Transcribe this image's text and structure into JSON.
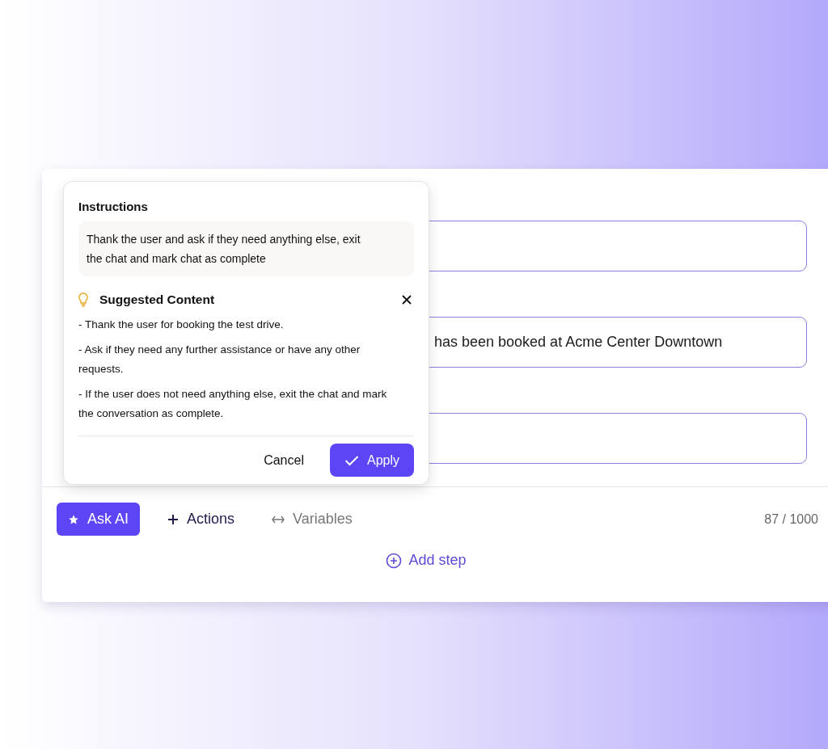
{
  "fields": [
    {
      "kind": "empty"
    },
    {
      "kind": "filled",
      "value": "has been booked at Acme Center Downtown"
    },
    {
      "kind": "empty"
    }
  ],
  "toolbar": {
    "ask_ai": "Ask AI",
    "actions": "Actions",
    "variables": "Variables",
    "counter": "87 / 1000"
  },
  "add_step": "Add step",
  "popup": {
    "instructions_title": "Instructions",
    "instructions_text": "Thank the user and ask if they need anything else, exit the chat and mark chat as complete",
    "suggested_title": "Suggested Content",
    "suggestions": [
      "- Thank the user for booking the test drive.",
      "- Ask if they need any further assistance or have any other requests.",
      "- If the user does not need anything else, exit the chat and mark the conversation as complete."
    ],
    "cancel": "Cancel",
    "apply": "Apply"
  }
}
